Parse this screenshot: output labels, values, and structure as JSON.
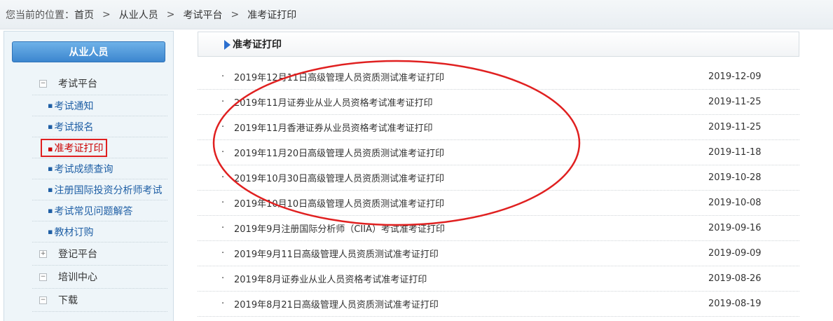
{
  "breadcrumb": {
    "prefix": "您当前的位置：",
    "items": [
      "首页",
      "从业人员",
      "考试平台",
      "准考证打印"
    ],
    "separator": ">"
  },
  "sidebar": {
    "header": "从业人员",
    "groups": [
      {
        "label": "考试平台",
        "toggle": "−",
        "expanded": true,
        "items": [
          {
            "label": "考试通知",
            "active": false
          },
          {
            "label": "考试报名",
            "active": false
          },
          {
            "label": "准考证打印",
            "active": true
          },
          {
            "label": "考试成绩查询",
            "active": false
          },
          {
            "label": "注册国际投资分析师考试",
            "active": false
          },
          {
            "label": "考试常见问题解答",
            "active": false
          },
          {
            "label": "教材订购",
            "active": false
          }
        ]
      },
      {
        "label": "登记平台",
        "toggle": "+",
        "expanded": false
      },
      {
        "label": "培训中心",
        "toggle": "−",
        "expanded": true
      },
      {
        "label": "下载",
        "toggle": "−",
        "expanded": true
      }
    ]
  },
  "main": {
    "title": "准考证打印",
    "rows": [
      {
        "bullet": "·",
        "title": "2019年12月11日高级管理人员资质测试准考证打印",
        "date": "2019-12-09"
      },
      {
        "bullet": "·",
        "title": "2019年11月证券业从业人员资格考试准考证打印",
        "date": "2019-11-25"
      },
      {
        "bullet": "·",
        "title": "2019年11月香港证券从业员资格考试准考证打印",
        "date": "2019-11-25"
      },
      {
        "bullet": "·",
        "title": "2019年11月20日高级管理人员资质测试准考证打印",
        "date": "2019-11-18"
      },
      {
        "bullet": "·",
        "title": "2019年10月30日高级管理人员资质测试准考证打印",
        "date": "2019-10-28"
      },
      {
        "bullet": "·",
        "title": "2019年10月10日高级管理人员资质测试准考证打印",
        "date": "2019-10-08"
      },
      {
        "bullet": "·",
        "title": "2019年9月注册国际分析师（CIIA）考试准考证打印",
        "date": "2019-09-16"
      },
      {
        "bullet": "·",
        "title": "2019年9月11日高级管理人员资质测试准考证打印",
        "date": "2019-09-09"
      },
      {
        "bullet": "·",
        "title": "2019年8月证券业从业人员资格考试准考证打印",
        "date": "2019-08-26"
      },
      {
        "bullet": "·",
        "title": "2019年8月21日高级管理人员资质测试准考证打印",
        "date": "2019-08-19"
      }
    ]
  },
  "colors": {
    "accent": "#3c86cf",
    "highlight": "#e02020",
    "link": "#1f5fa5"
  }
}
